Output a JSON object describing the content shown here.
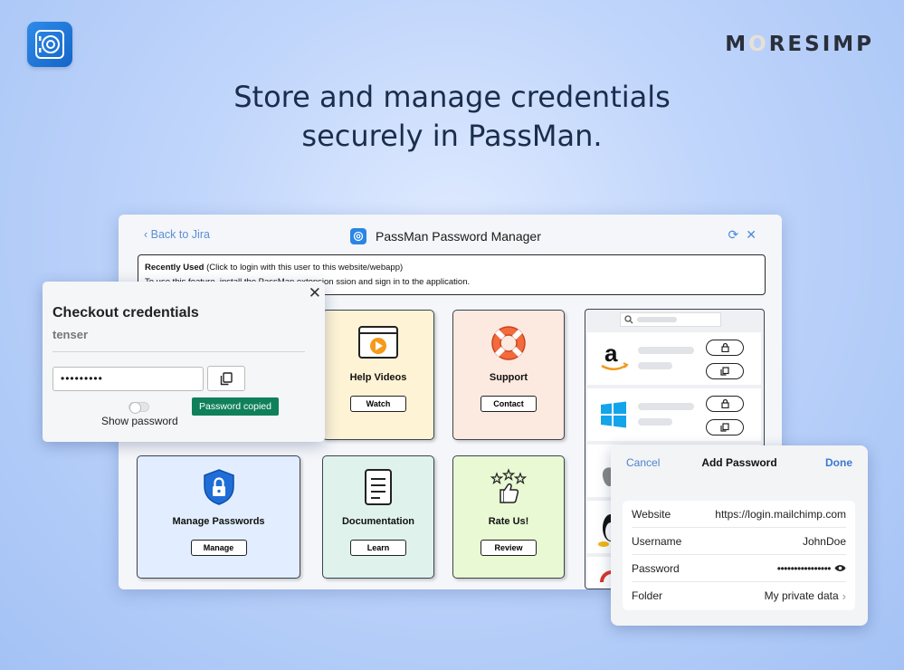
{
  "headline": {
    "line1": "Store and manage credentials",
    "line2": "securely in PassMan."
  },
  "brand": {
    "pre": "M",
    "o": "O",
    "post": "RESIMP"
  },
  "window": {
    "back_link": "Back to Jira",
    "title": "PassMan Password Manager",
    "icons": [
      "refresh-icon",
      "close-icon"
    ],
    "recent_label": "Recently Used",
    "recent_hint": " (Click to login with this user to this website/webapp)",
    "recent_line2_a": "To use this feature, install the PassMan extension",
    "recent_line2_b": "ssion and sign in to the application."
  },
  "cards": {
    "help": {
      "title": "Help Videos",
      "button": "Watch"
    },
    "support": {
      "title": "Support",
      "button": "Contact"
    },
    "manage": {
      "title": "Manage Passwords",
      "button": "Manage"
    },
    "docs": {
      "title": "Documentation",
      "button": "Learn"
    },
    "rate": {
      "title": "Rate Us!",
      "button": "Review"
    }
  },
  "checkout": {
    "title": "Checkout credentials",
    "username": "tenser",
    "password_masked": "•••••••••",
    "toast": "Password copied",
    "show_password": "Show password"
  },
  "add_password": {
    "cancel": "Cancel",
    "title": "Add Password",
    "done": "Done",
    "fields": [
      {
        "label": "Website",
        "value": "https://login.mailchimp.com"
      },
      {
        "label": "Username",
        "value": "JohnDoe"
      },
      {
        "label": "Password",
        "value": "••••••••••••••••"
      },
      {
        "label": "Folder",
        "value": "My private data"
      }
    ]
  },
  "colors": {
    "accent": "#3a78d3",
    "toast": "#10805a"
  }
}
